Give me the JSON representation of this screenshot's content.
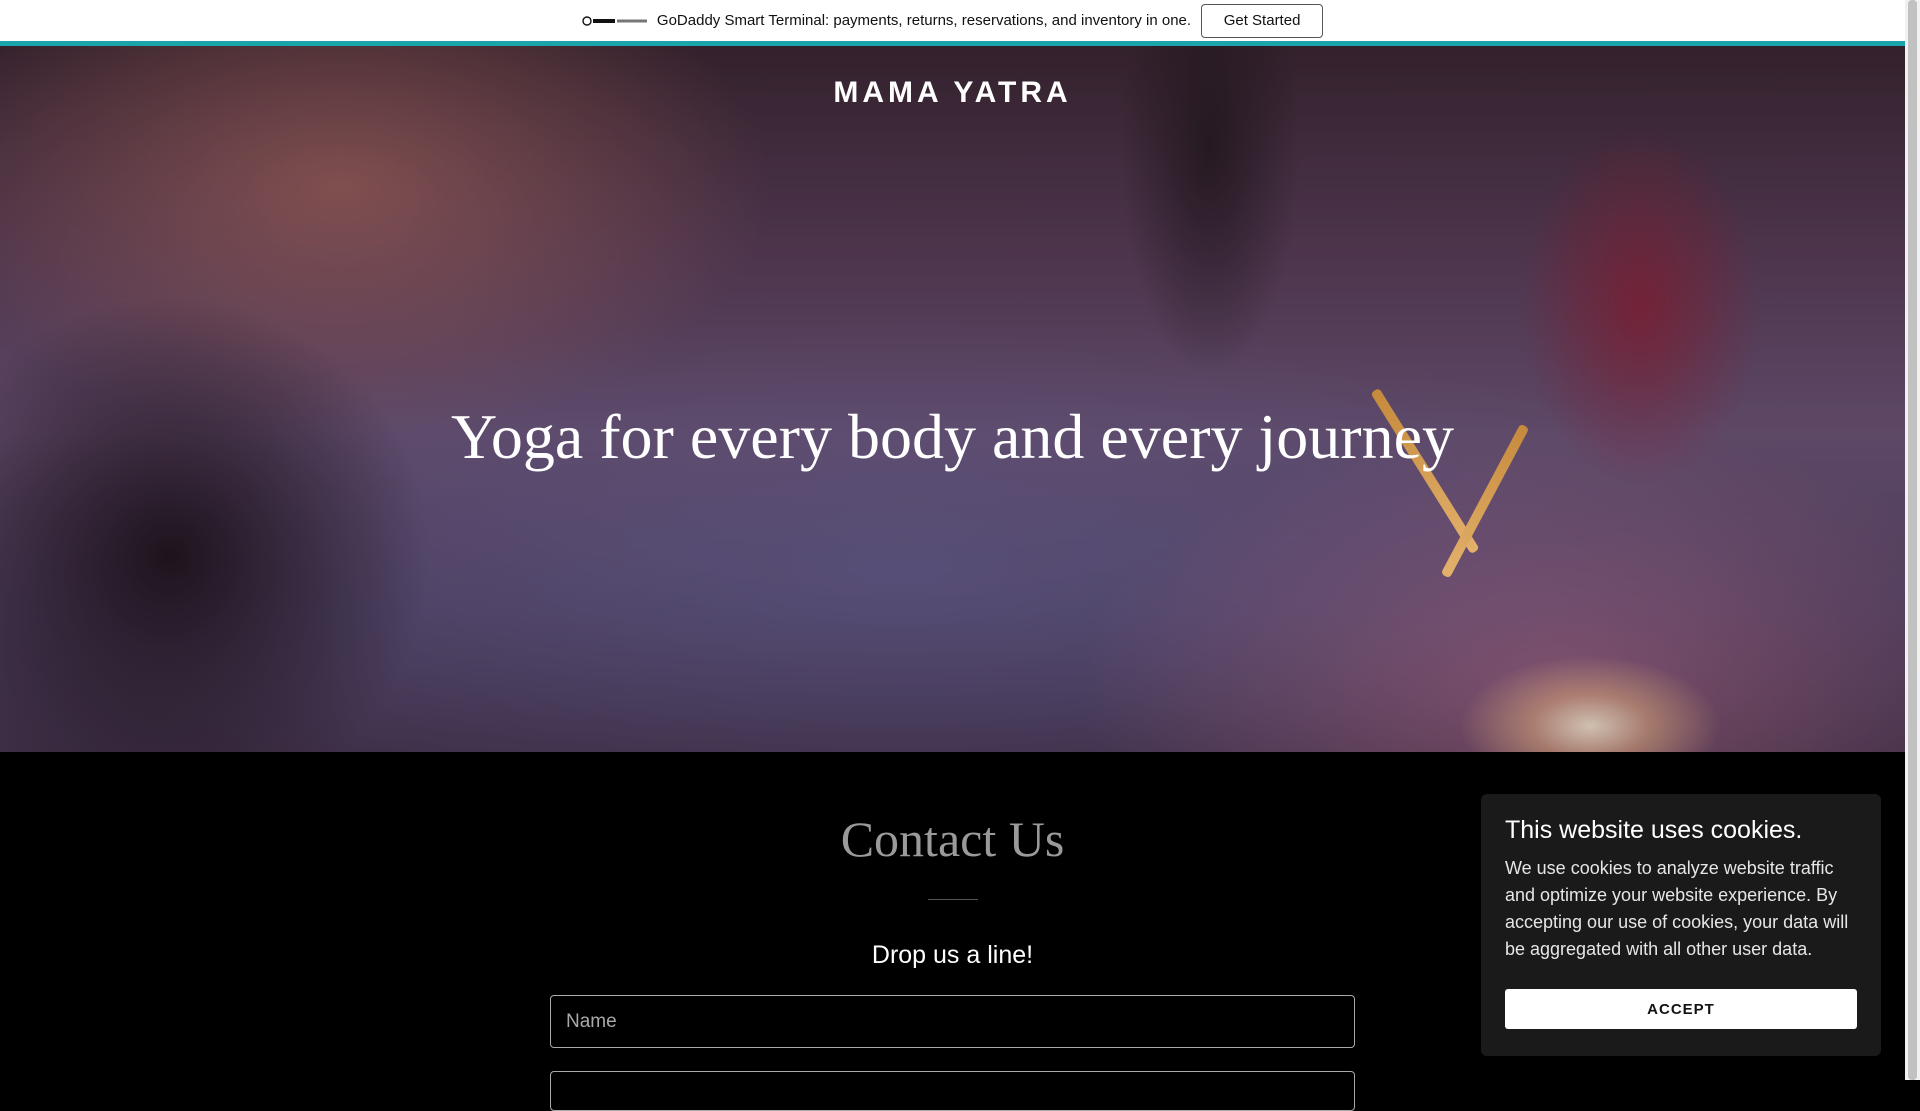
{
  "promo": {
    "logo_text": "GoDaddy Payments",
    "text": "GoDaddy Smart Terminal: payments, returns, reservations, and inventory in one.",
    "button_label": "Get Started",
    "accent_color": "#19a5a9"
  },
  "header": {
    "site_title": "MAMA YATRA"
  },
  "hero": {
    "heading": "Yoga for every body and every journey"
  },
  "contact": {
    "title": "Contact Us",
    "subtitle": "Drop us a line!",
    "name_placeholder": "Name"
  },
  "cookie_banner": {
    "title": "This website uses cookies.",
    "body": "We use cookies to analyze website traffic and optimize your website experience. By accepting our use of cookies, your data will be aggregated with all other user data.",
    "accept_label": "ACCEPT"
  }
}
